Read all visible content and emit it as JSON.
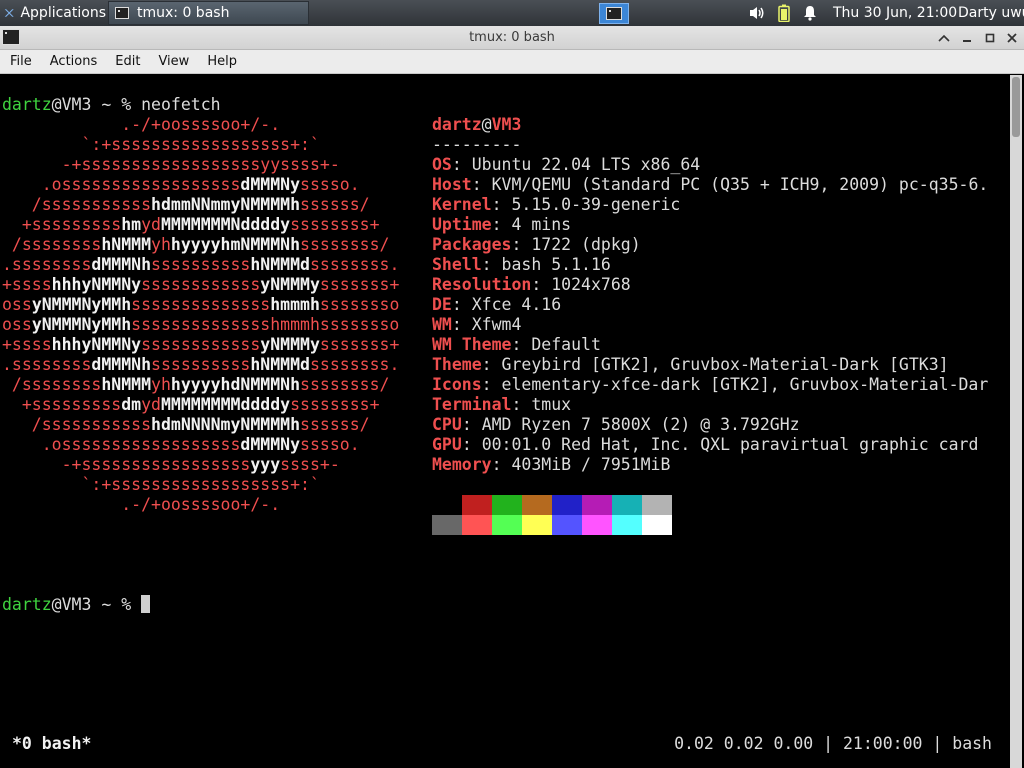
{
  "panel": {
    "applications_label": "Applications",
    "task_label": "tmux: 0 bash",
    "clock": "Thu 30 Jun, 21:00",
    "user": "Darty uwu",
    "icons": [
      "xfce-logo-icon",
      "terminal-icon",
      "volume-icon",
      "battery-icon",
      "notification-bell-icon"
    ]
  },
  "window": {
    "title": "tmux: 0 bash",
    "menu": [
      "File",
      "Actions",
      "Edit",
      "View",
      "Help"
    ]
  },
  "terminal": {
    "prompt_user": "dartz",
    "prompt_host": "@VM3",
    "prompt_rest": " ~ % ",
    "command": "neofetch",
    "logo_lines": [
      [
        [
          "r",
          "            .-/+oossssoo+/-."
        ]
      ],
      [
        [
          "r",
          "        `:+ssssssssssssssssss+:`"
        ]
      ],
      [
        [
          "r",
          "      -+ssssssssssssssssssyyssss+-"
        ]
      ],
      [
        [
          "r",
          "    .ossssssssssssssssss"
        ],
        [
          "w",
          "dMMMNy"
        ],
        [
          "r",
          "sssso."
        ]
      ],
      [
        [
          "r",
          "   /sssssssssss"
        ],
        [
          "w",
          "hdmmNNmmyNMMMMh"
        ],
        [
          "r",
          "ssssss/"
        ]
      ],
      [
        [
          "r",
          "  +sssssssss"
        ],
        [
          "w",
          "hm"
        ],
        [
          "r",
          "yd"
        ],
        [
          "w",
          "MMMMMMMNddddy"
        ],
        [
          "r",
          "ssssssss+"
        ]
      ],
      [
        [
          "r",
          " /ssssssss"
        ],
        [
          "w",
          "hNMMM"
        ],
        [
          "r",
          "yh"
        ],
        [
          "w",
          "hyyyyhmNMMMNh"
        ],
        [
          "r",
          "ssssssss/"
        ]
      ],
      [
        [
          "r",
          ".ssssssss"
        ],
        [
          "w",
          "dMMMNh"
        ],
        [
          "r",
          "ssssssssss"
        ],
        [
          "w",
          "hNMMMd"
        ],
        [
          "r",
          "ssssssss."
        ]
      ],
      [
        [
          "r",
          "+ssss"
        ],
        [
          "w",
          "hhhyNMMNy"
        ],
        [
          "r",
          "ssssssssssss"
        ],
        [
          "w",
          "yNMMMy"
        ],
        [
          "r",
          "sssssss+"
        ]
      ],
      [
        [
          "r",
          "oss"
        ],
        [
          "w",
          "yNMMMNyMMh"
        ],
        [
          "r",
          "ssssssssssssss"
        ],
        [
          "w",
          "hmmmh"
        ],
        [
          "r",
          "ssssssso"
        ]
      ],
      [
        [
          "r",
          "oss"
        ],
        [
          "w",
          "yNMMMNyMMh"
        ],
        [
          "r",
          "sssssssssssssshmmmhssssssso"
        ]
      ],
      [
        [
          "r",
          "+ssss"
        ],
        [
          "w",
          "hhhyNMMNy"
        ],
        [
          "r",
          "ssssssssssss"
        ],
        [
          "w",
          "yNMMMy"
        ],
        [
          "r",
          "sssssss+"
        ]
      ],
      [
        [
          "r",
          ".ssssssss"
        ],
        [
          "w",
          "dMMMNh"
        ],
        [
          "r",
          "ssssssssss"
        ],
        [
          "w",
          "hNMMMd"
        ],
        [
          "r",
          "ssssssss."
        ]
      ],
      [
        [
          "r",
          " /ssssssss"
        ],
        [
          "w",
          "hNMMM"
        ],
        [
          "r",
          "yh"
        ],
        [
          "w",
          "hyyyyhdNMMMNh"
        ],
        [
          "r",
          "ssssssss/"
        ]
      ],
      [
        [
          "r",
          "  +sssssssss"
        ],
        [
          "w",
          "dm"
        ],
        [
          "r",
          "yd"
        ],
        [
          "w",
          "MMMMMMMMddddy"
        ],
        [
          "r",
          "ssssssss+"
        ]
      ],
      [
        [
          "r",
          "   /sssssssssss"
        ],
        [
          "w",
          "hdmNNNNmyNMMMMh"
        ],
        [
          "r",
          "ssssss/"
        ]
      ],
      [
        [
          "r",
          "    .ossssssssssssssssss"
        ],
        [
          "w",
          "dMMMNy"
        ],
        [
          "r",
          "sssso."
        ]
      ],
      [
        [
          "r",
          "      -+sssssssssssssssss"
        ],
        [
          "w",
          "yyy"
        ],
        [
          "r",
          "ssss+-"
        ]
      ],
      [
        [
          "r",
          "        `:+ssssssssssssssssss+:`"
        ]
      ],
      [
        [
          "r",
          "            .-/+oossssoo+/-."
        ]
      ]
    ],
    "info_header_user": "dartz",
    "info_header_host": "VM3",
    "info_separator": "---------",
    "info": [
      {
        "key": "OS",
        "value": "Ubuntu 22.04 LTS x86_64"
      },
      {
        "key": "Host",
        "value": "KVM/QEMU (Standard PC (Q35 + ICH9, 2009) pc-q35-6."
      },
      {
        "key": "Kernel",
        "value": "5.15.0-39-generic"
      },
      {
        "key": "Uptime",
        "value": "4 mins"
      },
      {
        "key": "Packages",
        "value": "1722 (dpkg)"
      },
      {
        "key": "Shell",
        "value": "bash 5.1.16"
      },
      {
        "key": "Resolution",
        "value": "1024x768"
      },
      {
        "key": "DE",
        "value": "Xfce 4.16"
      },
      {
        "key": "WM",
        "value": "Xfwm4"
      },
      {
        "key": "WM Theme",
        "value": "Default"
      },
      {
        "key": "Theme",
        "value": "Greybird [GTK2], Gruvbox-Material-Dark [GTK3]"
      },
      {
        "key": "Icons",
        "value": "elementary-xfce-dark [GTK2], Gruvbox-Material-Dar"
      },
      {
        "key": "Terminal",
        "value": "tmux"
      },
      {
        "key": "CPU",
        "value": "AMD Ryzen 7 5800X (2) @ 3.792GHz"
      },
      {
        "key": "GPU",
        "value": "00:01.0 Red Hat, Inc. QXL paravirtual graphic card"
      },
      {
        "key": "Memory",
        "value": "403MiB / 7951MiB"
      }
    ],
    "palette_row1": [
      "#000000",
      "#c0201f",
      "#22b21d",
      "#b56a1f",
      "#2121c8",
      "#b51cb5",
      "#16b1b5",
      "#b3b3b3"
    ],
    "palette_row2": [
      "#686868",
      "#ff5454",
      "#54ff54",
      "#ffff54",
      "#5454ff",
      "#ff54ff",
      "#54ffff",
      "#ffffff"
    ],
    "second_prompt_command": ""
  },
  "tmux_status": {
    "left": "*0 bash*",
    "right": "0.02 0.02 0.00 | 21:00:00 | bash"
  },
  "colors": {
    "prompt_green": "#3fd43f",
    "neofetch_red": "#ef4f4f",
    "panel_bg": "#2f3338",
    "active_workspace": "#3c86d6"
  }
}
